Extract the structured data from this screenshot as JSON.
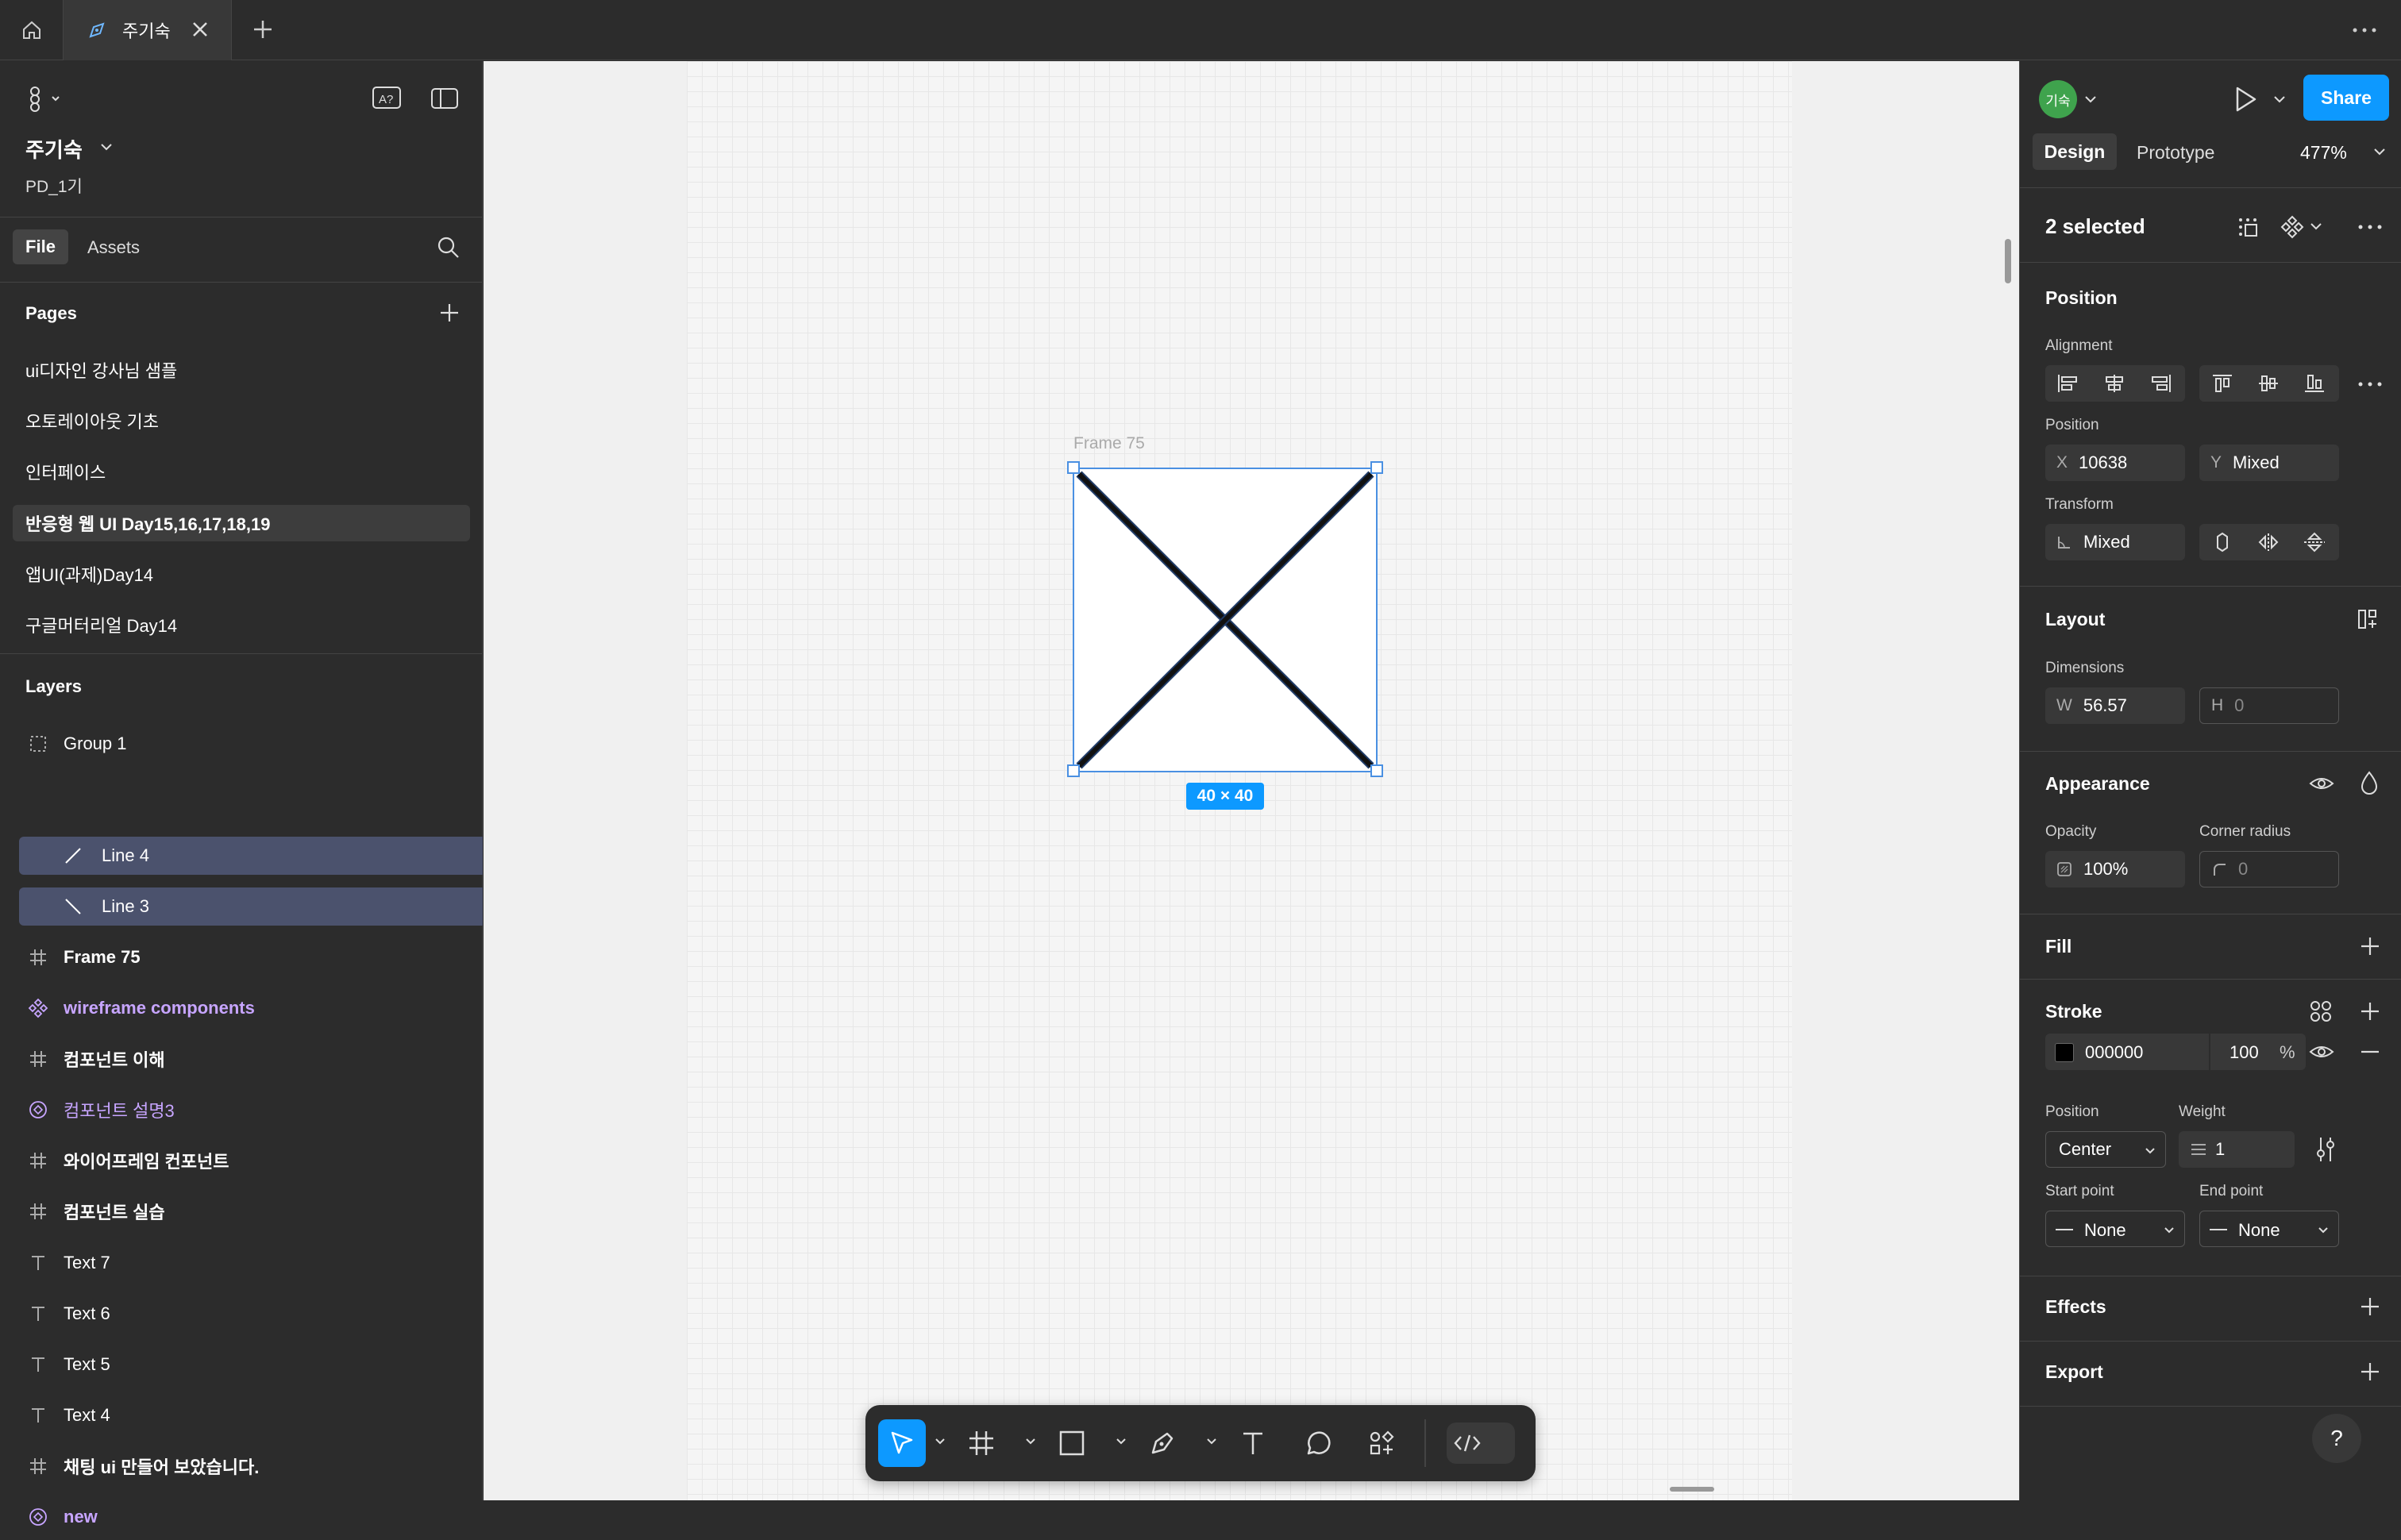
{
  "topbar": {
    "tab_title": "주기숙"
  },
  "left": {
    "file_name": "주기숙",
    "project": "PD_1기",
    "tabs": [
      "File",
      "Assets"
    ],
    "pages_title": "Pages",
    "pages": [
      {
        "label": "ui디자인 강사님 샘플"
      },
      {
        "label": "오토레이아웃 기초"
      },
      {
        "label": "인터페이스"
      },
      {
        "label": "반응형 웹 UI Day15,16,17,18,19"
      },
      {
        "label": "앱UI(과제)Day14"
      },
      {
        "label": "구글머터리얼 Day14"
      }
    ],
    "layers_title": "Layers",
    "layers": [
      {
        "label": "Group 1"
      },
      {
        "label": "Line 4"
      },
      {
        "label": "Line 3"
      },
      {
        "label": "Frame 75"
      },
      {
        "label": "wireframe components"
      },
      {
        "label": "컴포넌트 이해"
      },
      {
        "label": "컴포넌트 설명3"
      },
      {
        "label": "와이어프레임 컨포넌트"
      },
      {
        "label": "컴포넌트 실습"
      },
      {
        "label": "Text 7"
      },
      {
        "label": "Text 6"
      },
      {
        "label": "Text 5"
      },
      {
        "label": "Text 4"
      },
      {
        "label": "채팅 ui 만들어 보았습니다."
      },
      {
        "label": "new"
      }
    ]
  },
  "canvas": {
    "frame_label": "Frame 75",
    "size_badge": "40 × 40"
  },
  "right": {
    "avatar": "기숙",
    "share": "Share",
    "tabs": [
      "Design",
      "Prototype"
    ],
    "zoom": "477%",
    "selection": "2 selected",
    "position_title": "Position",
    "alignment_label": "Alignment",
    "position_label": "Position",
    "x_prefix": "X",
    "x_value": "10638",
    "y_prefix": "Y",
    "y_value": "Mixed",
    "transform_label": "Transform",
    "rotation_value": "Mixed",
    "layout_title": "Layout",
    "dimensions_label": "Dimensions",
    "w_prefix": "W",
    "w_value": "56.57",
    "h_prefix": "H",
    "h_value": "0",
    "appearance_title": "Appearance",
    "opacity_label": "Opacity",
    "opacity_value": "100%",
    "radius_label": "Corner radius",
    "radius_value": "0",
    "fill_title": "Fill",
    "stroke_title": "Stroke",
    "stroke_color": "000000",
    "stroke_opacity": "100",
    "stroke_pct": "%",
    "stroke_position_label": "Position",
    "stroke_position_value": "Center",
    "weight_label": "Weight",
    "weight_value": "1",
    "start_label": "Start point",
    "start_value": "None",
    "end_label": "End point",
    "end_value": "None",
    "effects_title": "Effects",
    "export_title": "Export",
    "help": "?"
  },
  "colors": {
    "accent": "#0d99ff",
    "panel": "#2c2c2c",
    "selection": "#4b526d",
    "component": "#c7a5ff"
  }
}
